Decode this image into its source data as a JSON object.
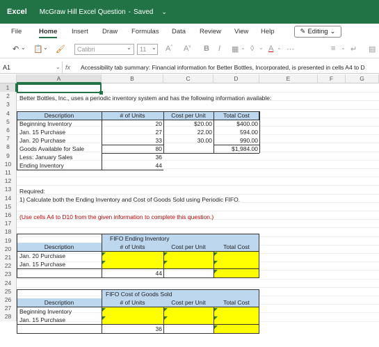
{
  "titlebar": {
    "app": "Excel",
    "doc_title": "McGraw Hill Excel Question",
    "save_state": "Saved"
  },
  "ribbon": {
    "tabs": [
      "File",
      "Home",
      "Insert",
      "Draw",
      "Formulas",
      "Data",
      "Review",
      "View",
      "Help"
    ],
    "active_tab": "Home",
    "editing_label": "Editing"
  },
  "toolbar": {
    "font_name": "Calibri",
    "font_size": "11"
  },
  "formula_bar": {
    "name_box": "A1",
    "fx": "fx",
    "content": "Accessibility tab summary: Financial information for Better Bottles, Incorporated, is presented in cells A4 to D"
  },
  "columns": [
    "A",
    "B",
    "C",
    "D",
    "E",
    "F",
    "G"
  ],
  "rows": [
    "1",
    "2",
    "3",
    "4",
    "5",
    "6",
    "7",
    "8",
    "9",
    "10",
    "11",
    "12",
    "13",
    "14",
    "15",
    "16",
    "17",
    "18",
    "19",
    "20",
    "21",
    "22",
    "23",
    "24",
    "25",
    "26",
    "27",
    "28"
  ],
  "sheet": {
    "intro": "Better Bottles, Inc., uses a periodic inventory system and has the following information available:",
    "table": {
      "headers": [
        "Description",
        "# of Units",
        "Cost per Unit",
        "Total Cost"
      ],
      "rows": [
        [
          "Beginning Inventory",
          "20",
          "$20.00",
          "$400.00"
        ],
        [
          "Jan. 15 Purchase",
          "27",
          "22.00",
          "594.00"
        ],
        [
          "Jan. 20 Purchase",
          "33",
          "30.00",
          "990.00"
        ],
        [
          "Goods Available for Sale",
          "80",
          "",
          "$1,984.00"
        ],
        [
          "Less: January Sales",
          "36",
          "",
          ""
        ],
        [
          "Ending Inventory",
          "44",
          "",
          ""
        ]
      ]
    },
    "required": "Required:",
    "question": "1) Calculate both the Ending Inventory and Cost of Goods Sold using Periodic FIFO.",
    "instruction": "(Use cells A4 to D10 from the given information to complete this question.)",
    "fifo_ei": {
      "title": "FIFO Ending Inventory",
      "headers": [
        "Description",
        "# of Units",
        "Cost per Unit",
        "Total Cost"
      ],
      "rows": [
        "Jan. 20 Purchase",
        "Jan. 15 Purchase"
      ],
      "total_units": "44"
    },
    "fifo_cogs": {
      "title": "FIFO Cost of Goods Sold",
      "headers": [
        "Description",
        "# of Units",
        "Cost per Unit",
        "Total Cost"
      ],
      "rows": [
        "Beginning Inventory",
        "Jan. 15 Purchase"
      ],
      "total_units": "36"
    }
  },
  "colors": {
    "excel_green": "#217346",
    "header_blue": "#bdd7ee",
    "input_yellow": "#ffff00",
    "instruction_red": "#c00000"
  }
}
